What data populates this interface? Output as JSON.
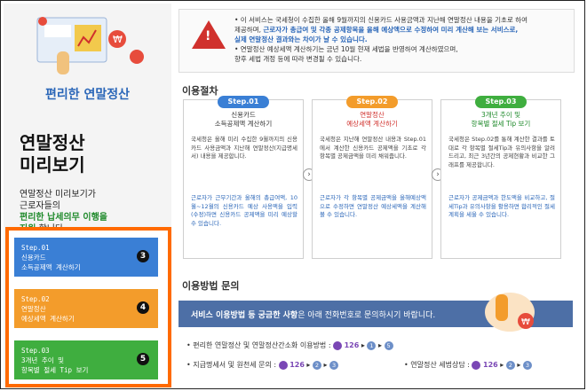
{
  "left": {
    "brand": "편리한 연말정산",
    "title_line1": "연말정산",
    "title_line2": "미리보기",
    "desc_1": "연말정산 미리보기가",
    "desc_2": "근로자들의",
    "desc_green": "편리한 납세의무 이행을",
    "desc_3": "지원",
    "desc_4": "합니다.",
    "steps": [
      {
        "line1": "Step.01",
        "line2": "신용카드",
        "line3": "소득공제액 계산하기",
        "badge": "3"
      },
      {
        "line1": "Step.02",
        "line2": "연말정산",
        "line3": "예상세액 계산하기",
        "badge": "4"
      },
      {
        "line1": "Step.03",
        "line2": "3개년 추이 및",
        "line3": "항목별 절세 Tip 보기",
        "badge": "5"
      }
    ]
  },
  "alert": {
    "l1": "• 이 서비스는 국세청이 수집한 올해 9월까지의 신용카드 사용금액과 지난해 연말정산 내용을 기초로 하여",
    "l2a": "제공하며,",
    "l2b": "근로자가 총급여 및 각종 공제항목을 올해 예상액으로 수정하여 미리 계산해 보는 서비스로,",
    "l3": "실제 연말정산 결과와는 차이가 날 수 있습니다.",
    "l4": "• 연말정산 예상세액 계산하기는 금년 10월 현재 세법을 반영하여 계산하였으며,",
    "l5": "향후 세법 개정 등에 따라 변경될 수 있습니다."
  },
  "procedure": {
    "title": "이용절차",
    "cards": [
      {
        "pill": "Step.01",
        "h1": "신용카드",
        "h2": "소득공제액 계산하기",
        "p1": "국세청은 올해 미리 수집한 9월까지의 신용카드 사용금액과 지난해 연말정산(지급명세서) 내용을 제공합니다.",
        "p2": "근로자가 근무기간과 올해의 총급여액, 10월~12월의 신용카드 예상 사용액을 입력(수정)하면 신용카드 공제액을 미리 예상할 수 있습니다."
      },
      {
        "pill": "Step.02",
        "h1": "연말정산",
        "h2": "예상세액 계산하기",
        "p1": "국세청은 지난해 연말정산 내용과 Step.01에서 계산한 신용카드 공제액을 기초로 각 항목별 공제금액을 미리 채워줍니다.",
        "p2": "근로자가 각 항목별 공제금액을 올해예상액으로 수정하면 연말정산 예상세액을 계산해 볼 수 있습니다."
      },
      {
        "pill": "Step.03",
        "h1": "3개년 추이 및",
        "h2": "항목별 절세 Tip 보기",
        "p1": "국세청은 Step.02를 통해 계산한 결과를 토대로 각 항목별 절세Tip과 유의사항을 알려드리고, 최근 3년간의 공제현황과 비교한 그래프를 제공합니다.",
        "p2": "근로자가 공제금액과 한도액을 비교하고, 절세Tip과 유의사항을 활용하면 합리적인 절세계획을 세울 수 있습니다."
      }
    ]
  },
  "inquiry": {
    "title": "이용방법 문의",
    "banner_bold": "서비스 이용방법 등 궁금한 사항",
    "banner_rest": "은 아래 전화번호로 문의하시기 바랍니다.",
    "row1_label": "• 편리한 연말정산 및 연말정산간소화 이용방법 :",
    "row1_num": "126",
    "row1_a": "1",
    "row1_b": "5",
    "row2_label": "• 지급명세서 및 원천세 문의 :",
    "row2_num": "126",
    "row2_a": "2",
    "row2_b": "3",
    "row3_label": "• 연말정산 세법상담 :",
    "row3_num": "126",
    "row3_a": "2",
    "row3_b": "3"
  },
  "colors": {
    "step1": "#3a7fd5",
    "step2": "#f39c2b",
    "step3": "#3fae3f",
    "highlight_border": "#ff6a00"
  }
}
